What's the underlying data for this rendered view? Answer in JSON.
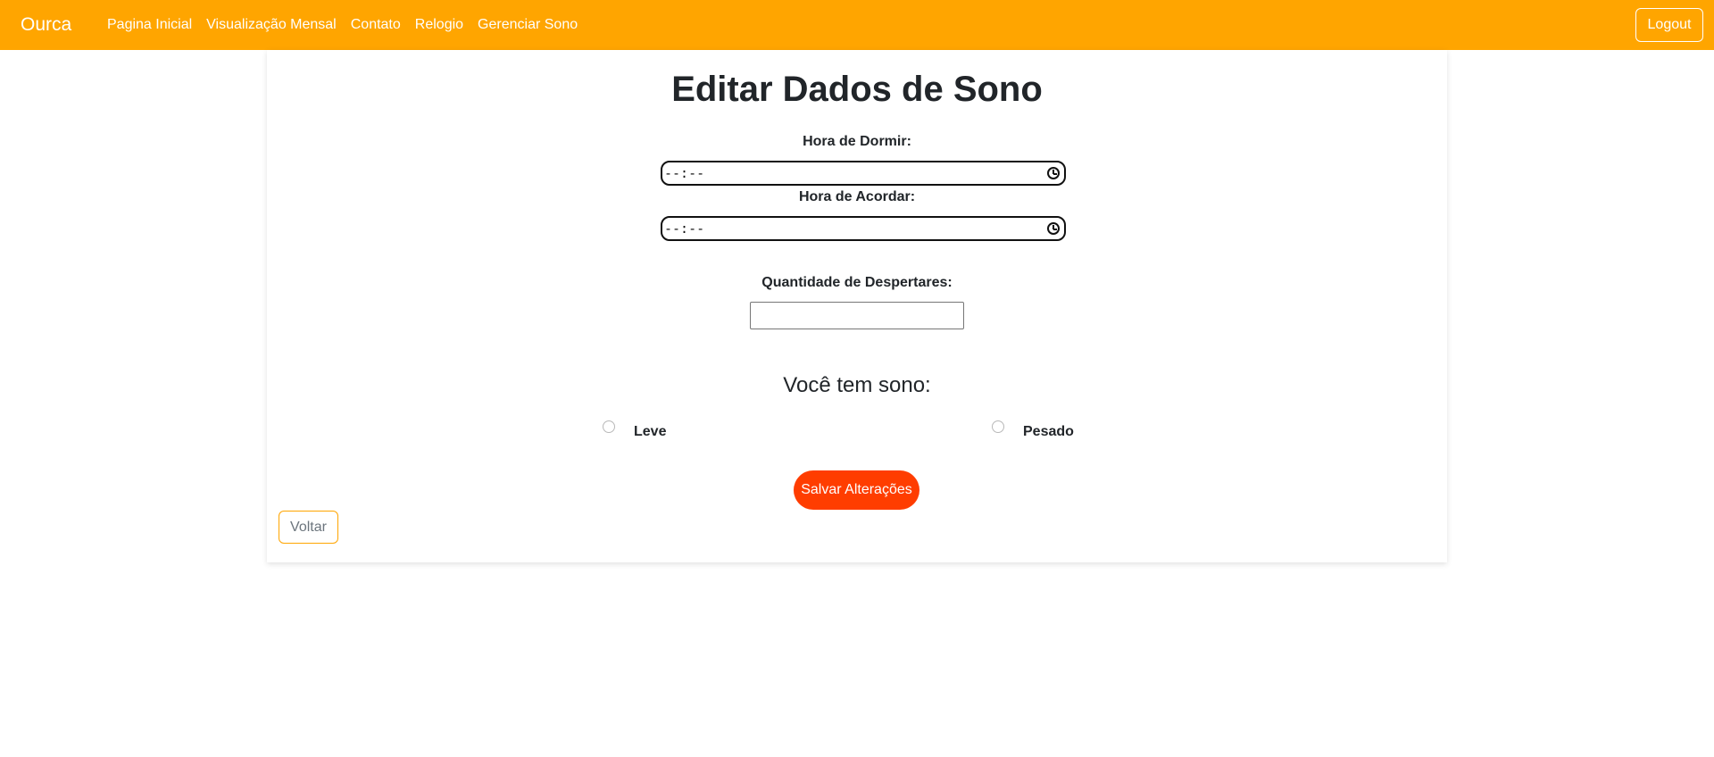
{
  "navbar": {
    "brand": "Ourca",
    "links": [
      "Pagina Inicial",
      "Visualização Mensal",
      "Contato",
      "Relogio",
      "Gerenciar Sono"
    ],
    "logout_label": "Logout",
    "color": "#ffa500"
  },
  "form": {
    "title": "Editar Dados de Sono",
    "sleep_label": "Hora de Dormir:",
    "sleep_value": "--:--",
    "wake_label": "Hora de Acordar:",
    "wake_value": "--:--",
    "awakenings_label": "Quantidade de Despertares:",
    "awakenings_value": "",
    "question": "Você tem sono:",
    "options": [
      "Leve",
      "Pesado"
    ],
    "save_label": "Salvar Alterações",
    "save_color": "#ff3d00",
    "back_label": "Voltar"
  }
}
